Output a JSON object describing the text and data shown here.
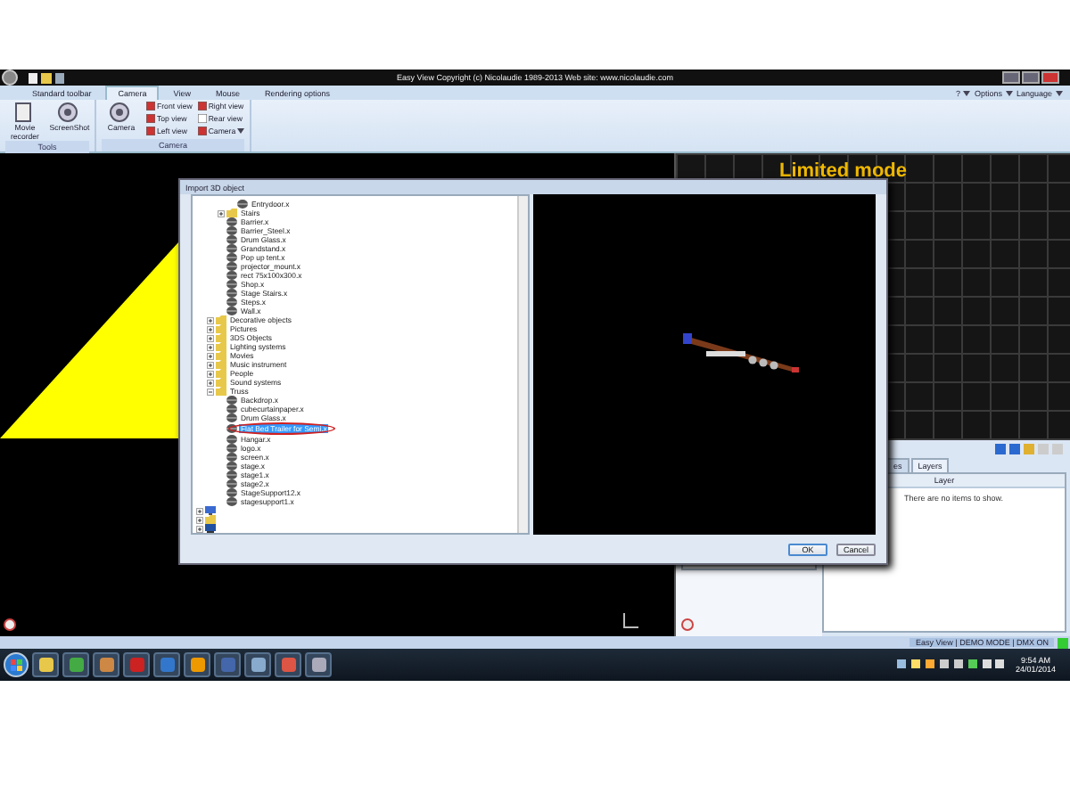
{
  "window": {
    "title": "Easy View   Copyright (c) Nicolaudie 1989-2013   Web site: www.nicolaudie.com"
  },
  "ribbon_tabs": [
    {
      "label": "Standard toolbar",
      "selected": false
    },
    {
      "label": "Camera",
      "selected": true
    },
    {
      "label": "View",
      "selected": false
    },
    {
      "label": "Mouse",
      "selected": false
    },
    {
      "label": "Rendering options",
      "selected": false
    }
  ],
  "ribbon_menu": [
    "?",
    "Options",
    "Language"
  ],
  "ribbon_groups": [
    {
      "label": "Tools",
      "buttons": [
        {
          "label": "Movie recorder",
          "kind": "large"
        },
        {
          "label": "ScreenShot",
          "kind": "large"
        }
      ]
    },
    {
      "label": "Camera",
      "buttons": [
        {
          "label": "Camera",
          "kind": "large"
        },
        {
          "label": "Front view",
          "kind": "small"
        },
        {
          "label": "Top view",
          "kind": "small"
        },
        {
          "label": "Left view",
          "kind": "small"
        },
        {
          "label": "Right view",
          "kind": "small"
        },
        {
          "label": "Rear view",
          "kind": "small"
        },
        {
          "label": "Camera",
          "kind": "small"
        }
      ]
    }
  ],
  "viewport": {
    "banner": "Limited mode"
  },
  "dialog": {
    "title": "Import 3D object",
    "tree": [
      {
        "children": [
          {
            "children": [
              {
                "children": [
                  {
                    "label": "Entrydoor.x",
                    "kind": "file",
                    "selected": false
                  }
                ]
              },
              {
                "label": "Stairs",
                "kind": "folder",
                "expanded": false,
                "selected": false
              },
              {
                "label": "Barrier.x",
                "kind": "file",
                "selected": false
              },
              {
                "label": "Barrier_Steel.x",
                "kind": "file",
                "selected": false
              },
              {
                "label": "Drum Glass.x",
                "kind": "file",
                "selected": false
              },
              {
                "label": "Grandstand.x",
                "kind": "file",
                "selected": false
              },
              {
                "label": "Pop up tent.x",
                "kind": "file",
                "selected": false
              },
              {
                "label": "projector_mount.x",
                "kind": "file",
                "selected": false
              },
              {
                "label": "rect 75x100x300.x",
                "kind": "file",
                "selected": false
              },
              {
                "label": "Shop.x",
                "kind": "file",
                "selected": false
              },
              {
                "label": "Stage Stairs.x",
                "kind": "file",
                "selected": false
              },
              {
                "label": "Steps.x",
                "kind": "file",
                "selected": false
              },
              {
                "label": "Wall.x",
                "kind": "file",
                "selected": false
              }
            ]
          },
          {
            "label": "Decorative objects",
            "kind": "folder",
            "expanded": false,
            "selected": false
          },
          {
            "label": "Pictures",
            "kind": "folder",
            "expanded": false,
            "selected": false
          },
          {
            "label": "3DS Objects",
            "kind": "folder",
            "expanded": false,
            "selected": false
          },
          {
            "label": "Lighting systems",
            "kind": "folder",
            "expanded": false,
            "selected": false
          },
          {
            "label": "Movies",
            "kind": "folder",
            "expanded": false,
            "selected": false
          },
          {
            "label": "Music instrument",
            "kind": "folder",
            "expanded": false,
            "selected": false
          },
          {
            "label": "People",
            "kind": "folder",
            "expanded": false,
            "selected": false
          },
          {
            "label": "Sound systems",
            "kind": "folder",
            "expanded": false,
            "selected": false
          },
          {
            "label": "Truss",
            "kind": "folder",
            "expanded": true,
            "selected": false,
            "children": [
              {
                "label": "Backdrop.x",
                "kind": "file",
                "selected": false
              },
              {
                "label": "cubecurtainpaper.x",
                "kind": "file",
                "selected": false
              },
              {
                "label": "Drum Glass.x",
                "kind": "file",
                "selected": false
              },
              {
                "label": "Flat Bed Trailer for Semi.x",
                "kind": "file",
                "selected": true
              },
              {
                "label": "Hangar.x",
                "kind": "file",
                "selected": false
              },
              {
                "label": "logo.x",
                "kind": "file",
                "selected": false
              },
              {
                "label": "screen.x",
                "kind": "file",
                "selected": false
              },
              {
                "label": "stage.x",
                "kind": "file",
                "selected": false
              },
              {
                "label": "stage1.x",
                "kind": "file",
                "selected": false
              },
              {
                "label": "stage2.x",
                "kind": "file",
                "selected": false
              },
              {
                "label": "StageSupport12.x",
                "kind": "file",
                "selected": false
              },
              {
                "label": "stagesupport1.x",
                "kind": "file",
                "selected": false
              }
            ]
          }
        ]
      },
      {
        "kind": "computer",
        "expanded": false
      },
      {
        "kind": "folder",
        "expanded": false
      },
      {
        "kind": "network",
        "expanded": false
      }
    ],
    "buttons": [
      "OK",
      "Cancel"
    ]
  },
  "layers_panel": {
    "tabs": [
      {
        "label": "es",
        "selected": false
      },
      {
        "label": "Layers",
        "selected": true
      }
    ],
    "column": "Layer",
    "empty_text": "There are no items to show."
  },
  "status_bar": "Easy View  |  DEMO MODE  |  DMX ON",
  "taskbar": {
    "time": "9:54 AM",
    "date": "24/01/2014"
  }
}
